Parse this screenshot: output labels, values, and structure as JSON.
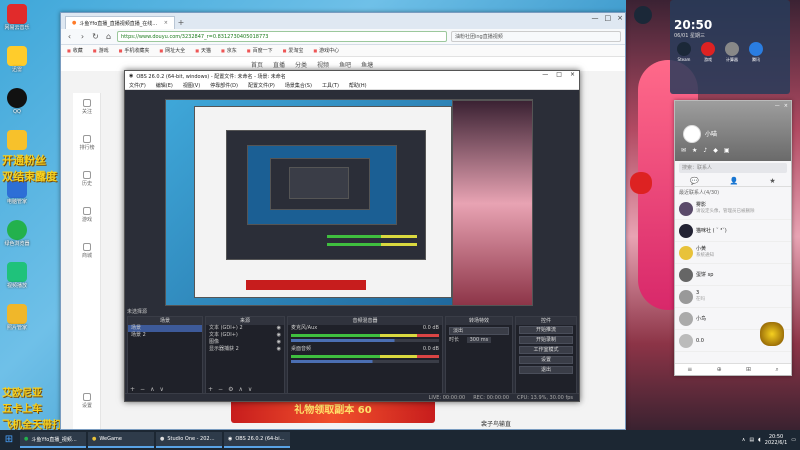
{
  "desktop": {
    "icons": [
      "网易云音乐",
      "迅雷",
      "QQ",
      "摸鱼游戏",
      "电脑管家",
      "绿色浏览器",
      "视频播放",
      "照片管家"
    ],
    "overlay_lines": [
      "开通粉丝",
      "双结束露度"
    ],
    "bottom_lines": [
      "艾欧尼亚",
      "五卡上车",
      "飞机全天带打"
    ]
  },
  "browser": {
    "tab_title": "斗鱼Yfo直播_直播视频直播_在线…",
    "url": "https://www.douyu.com/3232847_r=0.8312730405018773",
    "search_placeholder": "油粉社团ing直播视频",
    "bookmarks": [
      "收藏",
      "游戏",
      "手机收藏夹",
      "网址大全",
      "天猫",
      "京东",
      "百度一下",
      "爱淘宝",
      "游戏中心"
    ],
    "page_nav": [
      "首页",
      "直播",
      "分类",
      "视频",
      "鱼吧",
      "鱼塘"
    ],
    "sidebar": [
      "关注",
      "排行榜",
      "历史",
      "游戏",
      "商城",
      "设置"
    ],
    "banner_text": "礼物领取副本 60",
    "streamer_name": "裴子鸟输直"
  },
  "obs": {
    "title": "OBS 26.0.2 (64-bit, windows) - 配置文件: 未命名 - 场景: 未命名",
    "menu": [
      "文件(F)",
      "编辑(E)",
      "视图(V)",
      "停靠部件(D)",
      "配置文件(P)",
      "场景集合(S)",
      "工具(T)",
      "帮助(H)"
    ],
    "dock_title": "未选择源",
    "scenes_header": "场景",
    "scenes": [
      "场景",
      "场景 2"
    ],
    "sources_header": "来源",
    "sources": [
      "文本 (GDI+) 2",
      "文本 (GDI+)",
      "图像",
      "显示器捕获 2"
    ],
    "mixer_header": "音频混音器",
    "mixer": [
      {
        "name": "麦克风/Aux",
        "db": "0.0 dB",
        "level": 0.7
      },
      {
        "name": "桌面音频",
        "db": "0.0 dB",
        "level": 0.55
      }
    ],
    "transition_header": "转场特效",
    "transition_value": "淡出",
    "transition_duration_label": "时长",
    "transition_duration": "300 ms",
    "controls_header": "控件",
    "controls": [
      "开始推流",
      "开始录制",
      "工作室模式",
      "设置",
      "退出"
    ],
    "status": [
      "LIVE: 00:00:00",
      "REC: 00:00:00",
      "CPU: 13.9%, 30.00 fps"
    ]
  },
  "widget": {
    "time": "20:50",
    "date": "06/01 星期三",
    "apps": [
      "Steam",
      "游戏",
      "计算器",
      "腾讯"
    ]
  },
  "qq": {
    "nickname": "小喵",
    "search_placeholder": "搜索：联系人",
    "tabs": [
      "消息",
      "联系人",
      "空间"
    ],
    "group_label": "最近联系人(4/30)",
    "contacts": [
      {
        "name": "雾影",
        "msg": "请设定头像，管理员已被删除"
      },
      {
        "name": "猫咪社 ( ˘ ³˘)",
        "msg": ""
      },
      {
        "name": "小黄",
        "msg": "系统通知"
      },
      {
        "name": "蛋饼 sp",
        "msg": ""
      },
      {
        "name": "3",
        "msg": "在吗"
      },
      {
        "name": "小鸟",
        "msg": ""
      },
      {
        "name": "0.0",
        "msg": ""
      }
    ],
    "footer": [
      "≡",
      "⊕",
      "⊞",
      "⌕"
    ]
  },
  "taskbar": {
    "apps": [
      "斗鱼Yfo直播_视频…",
      "WeGame",
      "Studio One - 202…",
      "OBS 26.0.2 (64-bi…"
    ],
    "clock_time": "20:50",
    "clock_date": "2022/6/1"
  },
  "colors": {
    "obs_bg": "#2b2e38",
    "accent_blue": "#3d5a99",
    "douyu_orange": "#ff7a28",
    "banner_red": "#c71d1d"
  }
}
